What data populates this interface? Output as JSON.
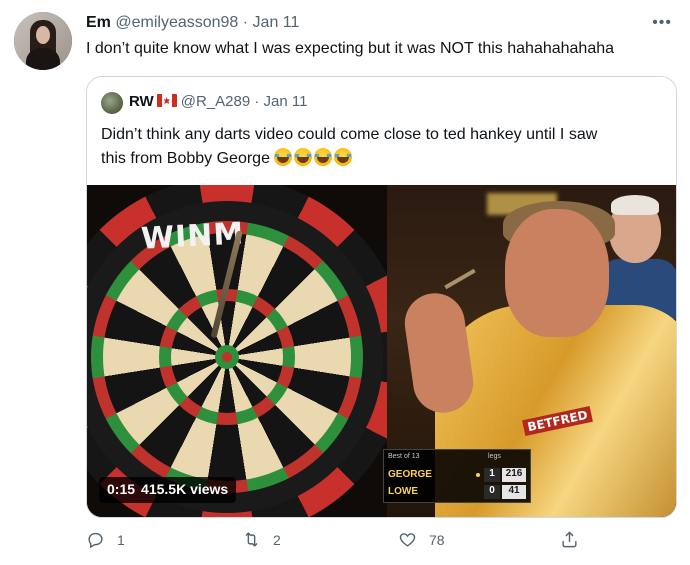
{
  "tweet": {
    "author_name": "Em",
    "author_handle": "@emilyeasson98",
    "separator": " · ",
    "date": "Jan 11",
    "text": "I don’t quite know what I was expecting but it was NOT this hahahahahaha",
    "more_icon": "more-icon"
  },
  "quote": {
    "author_name": "RW",
    "author_handle": "@R_A289",
    "separator": " · ",
    "date": "Jan 11",
    "flag_icon": "canada-flag-icon",
    "text_line1": "Didn’t think any darts video could come close to ted hankey until I saw",
    "text_line2": "this from Bobby George",
    "emoji_count": 4,
    "media": {
      "board_brand": "WINM",
      "board_numbers": "5  20  1",
      "sponsor": "BETFRED",
      "scoreboard": {
        "header": "Best of 13",
        "legs_label": "legs",
        "players": [
          {
            "name": "GEORGE",
            "legs": "1",
            "score": "216"
          },
          {
            "name": "LOWE",
            "legs": "0",
            "score": "41"
          }
        ]
      },
      "duration": "0:15",
      "views": "415.5K views"
    }
  },
  "actions": {
    "reply_count": "1",
    "retweet_count": "2",
    "like_count": "78",
    "colors": {
      "icon": "#536471"
    }
  }
}
